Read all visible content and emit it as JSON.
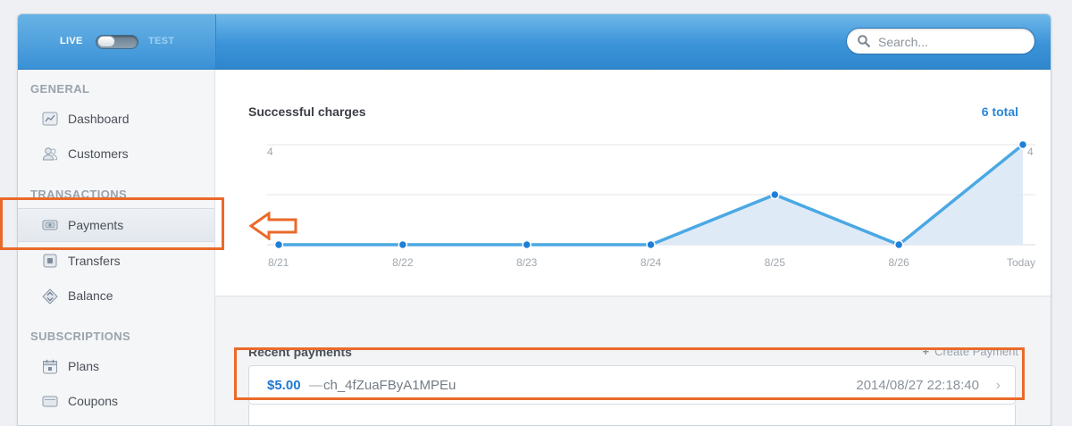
{
  "header": {
    "mode_live": "LIVE",
    "mode_test": "TEST",
    "search_placeholder": "Search..."
  },
  "sidebar": {
    "sections": [
      {
        "title": "GENERAL",
        "items": [
          {
            "label": "Dashboard",
            "icon": "dashboard-icon"
          },
          {
            "label": "Customers",
            "icon": "customers-icon"
          }
        ]
      },
      {
        "title": "TRANSACTIONS",
        "items": [
          {
            "label": "Payments",
            "icon": "payments-icon",
            "active": true
          },
          {
            "label": "Transfers",
            "icon": "transfers-icon"
          },
          {
            "label": "Balance",
            "icon": "balance-icon"
          }
        ]
      },
      {
        "title": "SUBSCRIPTIONS",
        "items": [
          {
            "label": "Plans",
            "icon": "calendar-icon"
          },
          {
            "label": "Coupons",
            "icon": "coupons-icon"
          }
        ]
      }
    ]
  },
  "chart": {
    "title": "Successful charges",
    "total": "6 total",
    "accent": "#4aa8e4"
  },
  "chart_data": {
    "type": "area",
    "title": "Successful charges",
    "categories": [
      "8/21",
      "8/22",
      "8/23",
      "8/24",
      "8/25",
      "8/26",
      "Today"
    ],
    "values": [
      0,
      0,
      0,
      0,
      2,
      0,
      4
    ],
    "ylim": [
      0,
      4
    ],
    "y_tick_label_left": "4",
    "y_tick_label_right": "4",
    "grid": true
  },
  "recent": {
    "title": "Recent payments",
    "create_label": "Create Payment",
    "payments": [
      {
        "amount": "$5.00",
        "separator": "—",
        "id": "ch_4fZuaFByA1MPEu",
        "date": "2014/08/27 22:18:40"
      }
    ]
  },
  "annotation": {
    "color": "#ea6a2a"
  }
}
